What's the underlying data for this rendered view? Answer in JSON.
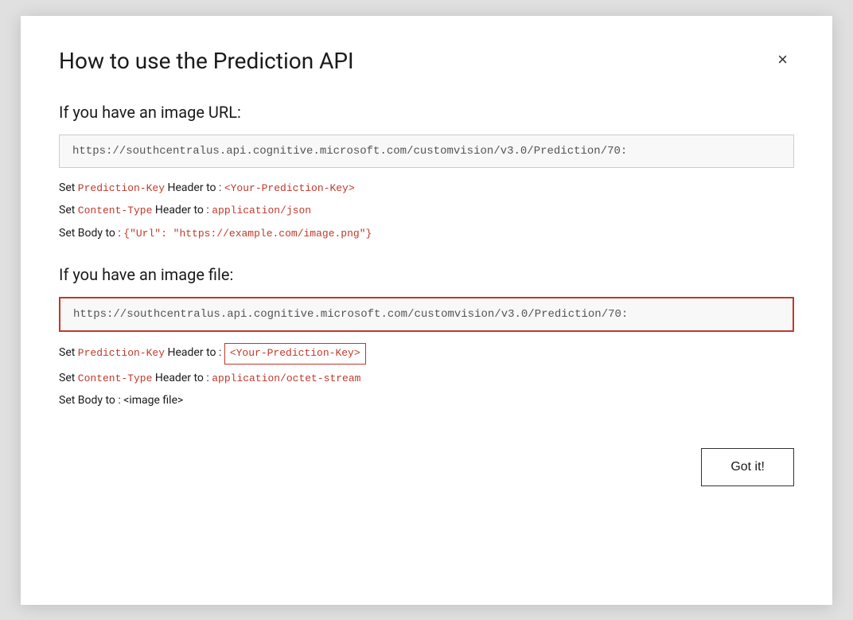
{
  "modal": {
    "title": "How to use the Prediction API",
    "close_label": "×"
  },
  "section_url": {
    "title": "If you have an image URL:",
    "url": "https://southcentralus.api.cognitive.microsoft.com/customvision/v3.0/Prediction/70:",
    "line1_prefix": "Set ",
    "line1_key": "Prediction-Key",
    "line1_middle": " Header to : ",
    "line1_value": "<Your-Prediction-Key>",
    "line2_prefix": "Set ",
    "line2_key": "Content-Type",
    "line2_middle": " Header to : ",
    "line2_value": "application/json",
    "line3_prefix": "Set Body to : ",
    "line3_value": "{\"Url\": \"https://example.com/image.png\"}"
  },
  "section_file": {
    "title": "If you have an image file:",
    "url": "https://southcentralus.api.cognitive.microsoft.com/customvision/v3.0/Prediction/70:",
    "line1_prefix": "Set ",
    "line1_key": "Prediction-Key",
    "line1_middle": " Header to : ",
    "line1_value": "<Your-Prediction-Key>",
    "line2_prefix": "Set ",
    "line2_key": "Content-Type",
    "line2_middle": " Header to : ",
    "line2_value": "application/octet-stream",
    "line3_prefix": "Set Body to : <image file>"
  },
  "footer": {
    "got_it_label": "Got it!"
  }
}
